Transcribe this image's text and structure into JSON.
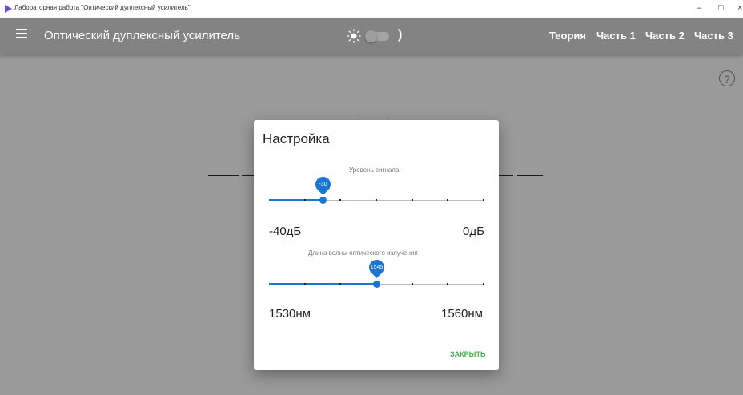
{
  "window": {
    "title": "Лабораторная работа \"Оптический дуплексный усилитель\"",
    "minimize": "–",
    "maximize": "□",
    "close": "×"
  },
  "appbar": {
    "title": "Оптический дуплексный усилитель",
    "moon": ")",
    "tabs": [
      "Теория",
      "Часть 1",
      "Часть 2",
      "Часть 3"
    ]
  },
  "help": {
    "icon": "?"
  },
  "dialog": {
    "title": "Настройка",
    "signal": {
      "label": "Уровень сигнала",
      "value": "-30",
      "min_label": "-40дБ",
      "max_label": "0дБ",
      "min": -40,
      "max": 0,
      "current": -30
    },
    "wavelength": {
      "label": "Длина волны оптического излучения",
      "value": "1545",
      "min_label": "1530нм",
      "max_label": "1560нм",
      "min": 1530,
      "max": 1560,
      "current": 1545
    },
    "close_label": "ЗАКРЫТЬ"
  },
  "colors": {
    "accent": "#1976d2",
    "close_button": "#4caf50",
    "appbar": "#838383",
    "backdrop": "#9a9a9a"
  },
  "icons": [
    "menu-icon",
    "sun-icon",
    "moon-icon",
    "help-icon"
  ]
}
